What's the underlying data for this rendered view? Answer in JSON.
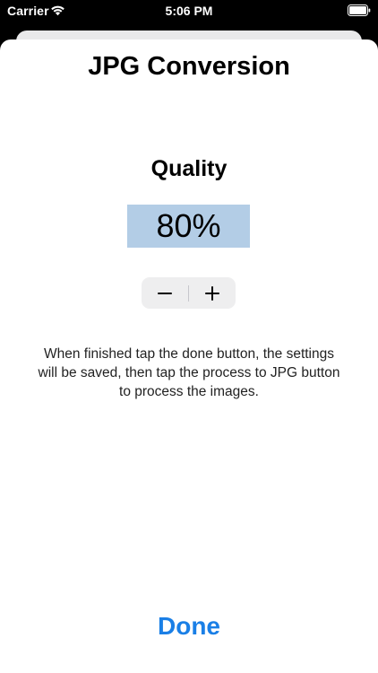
{
  "status_bar": {
    "carrier": "Carrier",
    "time": "5:06 PM",
    "wifi_icon": "wifi-icon",
    "battery_icon": "battery-icon"
  },
  "sheet": {
    "title": "JPG Conversion",
    "quality_label": "Quality",
    "quality_value": "80%",
    "stepper": {
      "minus_icon": "minus-icon",
      "plus_icon": "plus-icon"
    },
    "instructions": "When finished tap the done button, the settings will be saved, then tap the process to JPG button to process the images.",
    "done_label": "Done"
  },
  "colors": {
    "accent": "#1a7fe6",
    "quality_highlight": "#b3cde6",
    "stepper_background": "#eeeeef"
  }
}
